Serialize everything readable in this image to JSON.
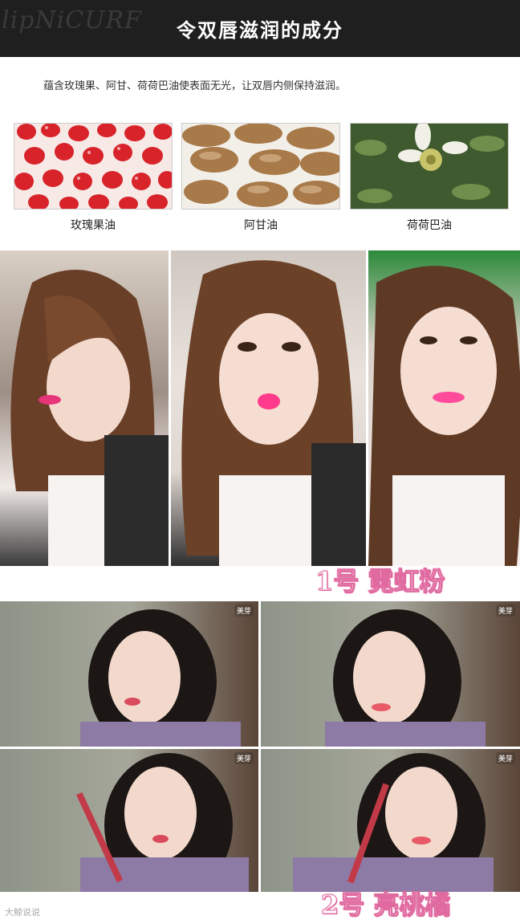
{
  "header": {
    "script_text": "lipNiCURF",
    "title": "令双唇滋润的成分"
  },
  "intro": "蕴含玫瑰果、阿甘、荷荷巴油使表面无光，让双唇内侧保持滋润。",
  "ingredients": [
    {
      "label": "玫瑰果油"
    },
    {
      "label": "阿甘油"
    },
    {
      "label": "荷荷巴油"
    }
  ],
  "shade1": {
    "label": "1号 霓虹粉"
  },
  "shade2": {
    "label": "2号 亮桃橘"
  },
  "watermark": "美芽",
  "bottom_logo": "大鲸说说",
  "colors": {
    "header_bg": "#1f1f1f",
    "label_outline": "#e06aa0"
  }
}
